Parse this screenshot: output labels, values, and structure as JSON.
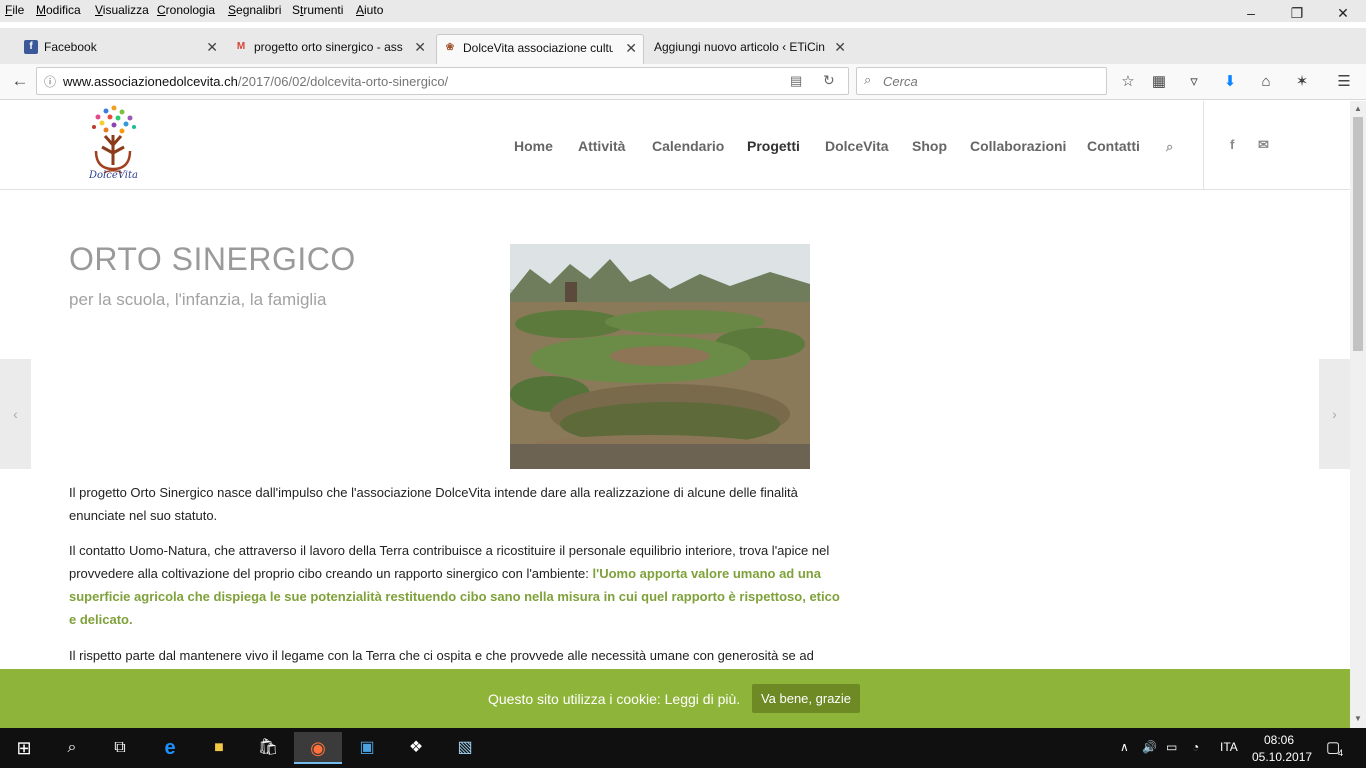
{
  "menubar": {
    "items": [
      {
        "label": "File",
        "accel": "F"
      },
      {
        "label": "Modifica",
        "accel": "M"
      },
      {
        "label": "Visualizza",
        "accel": "V"
      },
      {
        "label": "Cronologia",
        "accel": "C"
      },
      {
        "label": "Segnalibri",
        "accel": "S"
      },
      {
        "label": "Strumenti",
        "accel": "t"
      },
      {
        "label": "Aiuto",
        "accel": "A"
      }
    ]
  },
  "tabs": [
    {
      "title": "Facebook",
      "favicon": "facebook-icon"
    },
    {
      "title": "progetto orto sinergico - ass",
      "favicon": "gmail-icon"
    },
    {
      "title": "DolceVita associazione cultu",
      "favicon": "dolcevita-icon"
    },
    {
      "title": "Aggiungi nuovo articolo ‹ ETiCin",
      "favicon": "none"
    }
  ],
  "address": {
    "domain": "www.associazionedolcevita.ch",
    "path": "/2017/06/02/dolcevita-orto-sinergico/"
  },
  "search": {
    "placeholder": "Cerca"
  },
  "site": {
    "logo_text": "DolceVita",
    "nav": [
      "Home",
      "Attività",
      "Calendario",
      "Progetti",
      "DolceVita",
      "Shop",
      "Collaborazioni",
      "Contatti"
    ],
    "social": [
      "f",
      "✉"
    ]
  },
  "article": {
    "title": "ORTO SINERGICO",
    "subtitle": "per la scuola, l'infanzia, la famiglia",
    "p1": "Il progetto Orto Sinergico nasce dall'impulso che l'associazione DolceVita intende dare alla realizzazione di alcune delle finalità enunciate nel suo statuto.",
    "p2_plain": "Il contatto Uomo-Natura, che attraverso il lavoro della Terra contribuisce a ricostituire il personale equilibrio interiore, trova l'apice nel provvedere alla coltivazione del proprio cibo creando un rapporto sinergico con l'ambiente: ",
    "p2_highlight": "l'Uomo apporta valore umano ad una superficie agricola che dispiega le sue potenzialità restituendo cibo sano nella misura in cui quel rapporto è rispettoso, etico e delicato.",
    "p3": "Il rispetto parte dal mantenere vivo il legame con la Terra che ci ospita e che provvede alle necessità umane con generosità se ad"
  },
  "cookie": {
    "text": "Questo sito utilizza i cookie: Leggi di più.",
    "button": "Va bene, grazie"
  },
  "taskbar": {
    "language": "ITA",
    "time": "08:06",
    "date": "05.10.2017",
    "notifications": "4"
  },
  "colors": {
    "accent_green": "#8fb43a",
    "highlight_text": "#7fa13a"
  }
}
